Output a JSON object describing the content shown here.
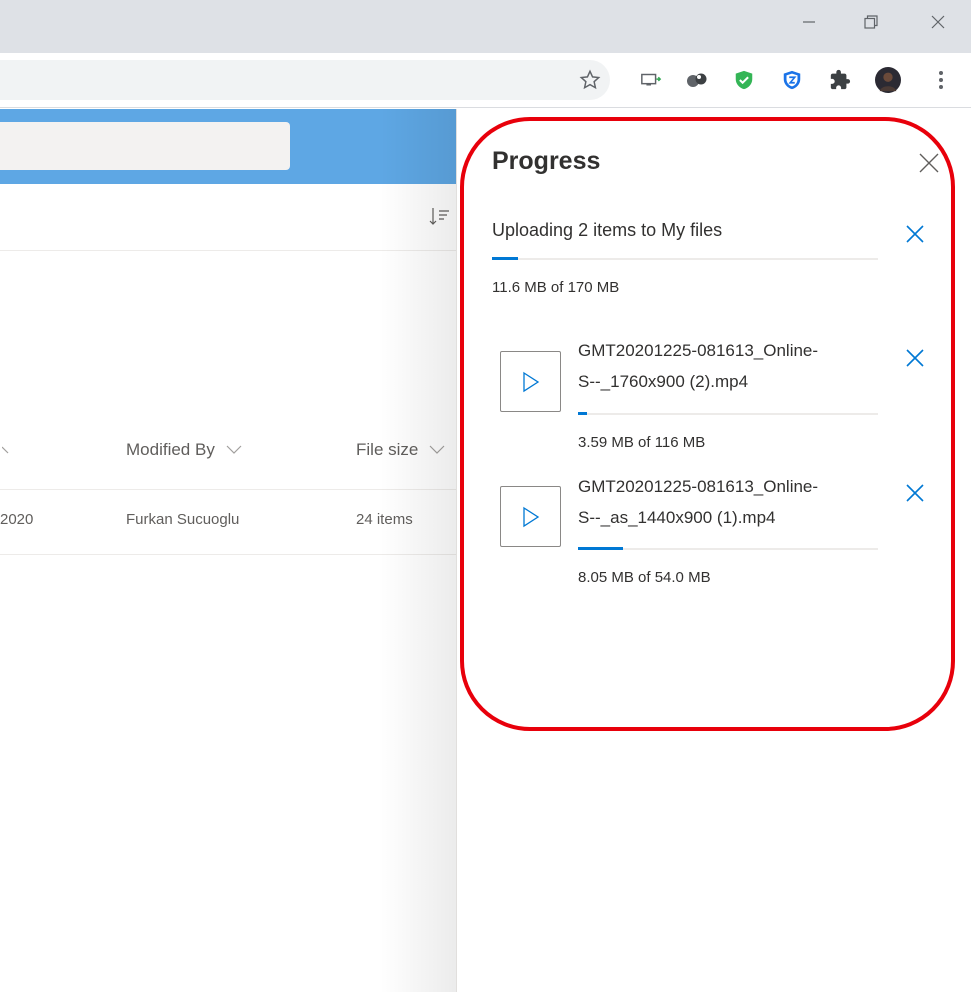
{
  "browser": {
    "window_controls": {
      "minimize_icon": "minimize-icon",
      "restore_icon": "restore-icon",
      "close_icon": "close-icon"
    },
    "extensions": [
      "star-icon",
      "cast-icon",
      "extension-dots-icon",
      "shield-check-icon",
      "vpn-shield-icon",
      "puzzle-icon",
      "avatar",
      "more-vert-icon"
    ]
  },
  "list": {
    "columns": {
      "modified_by": "Modified By",
      "file_size": "File size"
    },
    "rows": [
      {
        "modified": "2020",
        "modified_by": "Furkan Sucuoglu",
        "file_size": "24 items"
      }
    ]
  },
  "panel": {
    "title": "Progress",
    "summary": {
      "label": "Uploading 2 items to My files",
      "progress_text": "11.6 MB of 170 MB",
      "progress": 0.068
    },
    "files": [
      {
        "name_line1": "GMT20201225-081613_Online-",
        "name_line2": "S--_1760x900 (2).mp4",
        "progress_text": "3.59 MB of 116 MB",
        "progress": 0.031
      },
      {
        "name_line1": "GMT20201225-081613_Online-",
        "name_line2": "S--_as_1440x900 (1).mp4",
        "progress_text": "8.05 MB of 54.0 MB",
        "progress": 0.149
      }
    ]
  },
  "colors": {
    "accent": "#0078d4",
    "header": "#5ea7e4",
    "annotation": "#e8000b"
  }
}
